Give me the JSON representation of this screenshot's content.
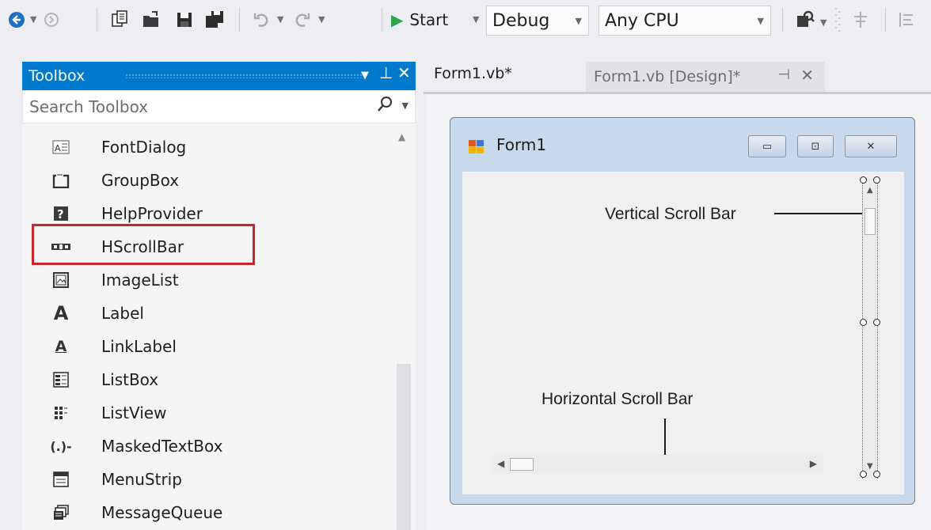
{
  "toolbar": {
    "start_label": "Start",
    "config_value": "Debug",
    "platform_value": "Any CPU",
    "icons": [
      "back-icon",
      "forward-icon",
      "new-project-icon",
      "open-file-icon",
      "save-icon",
      "save-all-icon",
      "undo-icon",
      "redo-icon",
      "start-icon",
      "find-icon",
      "align-icon"
    ]
  },
  "toolbox": {
    "title": "Toolbox",
    "search_placeholder": "Search Toolbox",
    "items": [
      {
        "label": "FontDialog",
        "icon": "font-dialog-icon"
      },
      {
        "label": "GroupBox",
        "icon": "group-box-icon"
      },
      {
        "label": "HelpProvider",
        "icon": "help-provider-icon"
      },
      {
        "label": "HScrollBar",
        "icon": "hscrollbar-icon"
      },
      {
        "label": "ImageList",
        "icon": "image-list-icon"
      },
      {
        "label": "Label",
        "icon": "label-icon"
      },
      {
        "label": "LinkLabel",
        "icon": "link-label-icon"
      },
      {
        "label": "ListBox",
        "icon": "list-box-icon"
      },
      {
        "label": "ListView",
        "icon": "list-view-icon"
      },
      {
        "label": "MaskedTextBox",
        "icon": "masked-textbox-icon"
      },
      {
        "label": "MenuStrip",
        "icon": "menu-strip-icon"
      },
      {
        "label": "MessageQueue",
        "icon": "message-queue-icon"
      }
    ],
    "highlighted_item": "HScrollBar"
  },
  "tabs": [
    {
      "label": "Form1.vb*",
      "active": true
    },
    {
      "label": "Form1.vb [Design]*",
      "active": false
    }
  ],
  "form": {
    "title": "Form1",
    "vertical_label": "Vertical Scroll Bar",
    "horizontal_label": "Horizontal Scroll Bar"
  },
  "colors": {
    "accent": "#007acc",
    "highlight": "#c8242b",
    "form_frame": "#c9d9ec"
  }
}
